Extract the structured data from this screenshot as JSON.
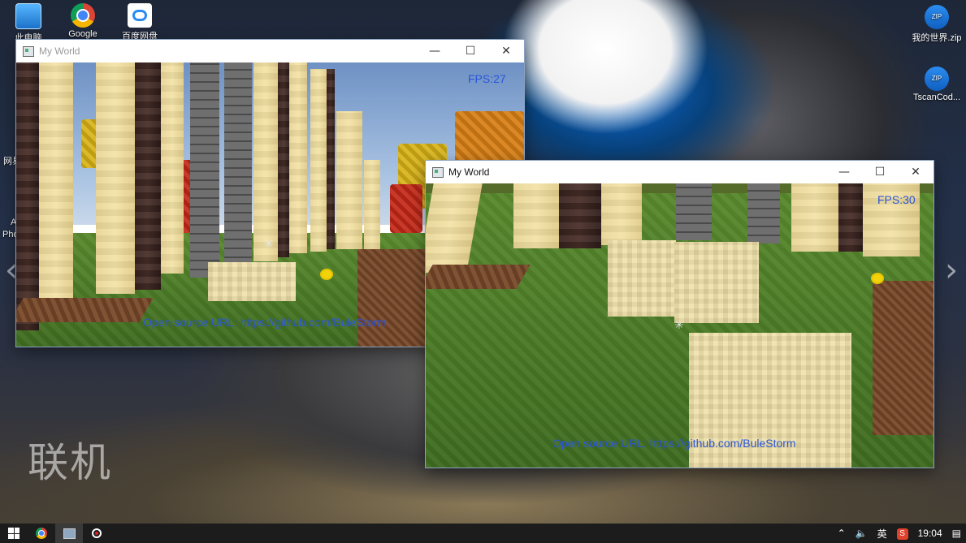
{
  "desktop": {
    "icons_left": [
      {
        "label": "此电脑",
        "icon": "computer-icon"
      },
      {
        "label": "Google",
        "icon": "chrome-icon"
      },
      {
        "label": "百度网盘",
        "icon": "baidu-netdisk-icon"
      }
    ],
    "icons_right": [
      {
        "label": "我的世界.zip",
        "icon": "zip-archive-icon"
      },
      {
        "label": "TscanCod...",
        "icon": "zip-archive-icon"
      }
    ],
    "partial_labels": [
      "网易",
      "A",
      "Pho"
    ],
    "watermark": "联机"
  },
  "windows": [
    {
      "title": "My World",
      "fps": "FPS:27",
      "source_url": "Open source URL: https://github.com/BuleStorm",
      "controls": {
        "minimize": "—",
        "maximize": "☐",
        "close": "✕"
      }
    },
    {
      "title": "My World",
      "fps": "FPS:30",
      "source_url": "Open source URL: https://github.com/BuleStorm",
      "controls": {
        "minimize": "—",
        "maximize": "☐",
        "close": "✕"
      }
    }
  ],
  "taskbar": {
    "ime": "英",
    "clock": "19:04",
    "input_method_badge": "S"
  },
  "colors": {
    "overlay_text": "#2a55d8",
    "taskbar": "#1c1c1c",
    "sand": "#efe0a8",
    "grass": "#4d7d28"
  }
}
